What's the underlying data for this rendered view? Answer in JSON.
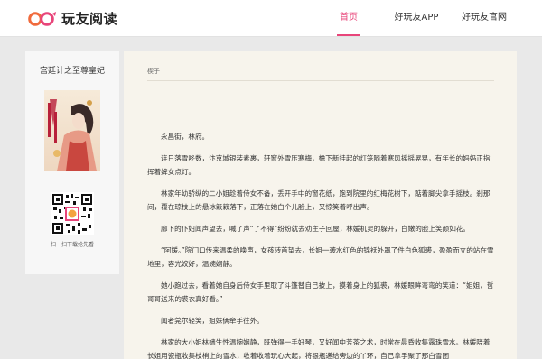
{
  "header": {
    "logo_text": "玩友阅读",
    "nav": [
      {
        "label": "首页",
        "active": true
      },
      {
        "label": "好玩友APP",
        "active": false
      },
      {
        "label": "好玩友官网",
        "active": false
      }
    ],
    "accent_color": "#e8457a"
  },
  "sidebar": {
    "book_title": "宫廷计之至尊皇妃",
    "scan_label": "扫一扫下载抢先看"
  },
  "main": {
    "breadcrumb": "楔子",
    "paragraphs": [
      "永昌街，林府。",
      "连日落雪咚数，汴京城银装素裹，轩窗外雪压寒梅，檐下新挂起的灯笼随着寒风摇摇晃晃，有年长的妈妈正指挥着婢女点灯。",
      "林家年幼骄纵的二小姐趁着侍女不备，丢开手中的窗花纸，跑到院里的红梅花树下，踮着脚尖拿手摇枝。剎那间，覆在琼枝上的悬冰簌簌落下，正落在她白个儿脸上，又惊笑着呼出声。",
      "廊下的仆妇闻声望去，喊了声“了不得”纷纷就去劝主子回屋，林媛机灵的躲开，白嫩的脸上笑颜如花。",
      "“阿媛。”院门口传来温柔的唤声，女孩转首望去，长姐一袭水红色的锦袄外罩了件白色狐裘，盈盈而立的站在雪地里，容光姣好，温婉娴静。",
      "她小跑过去，看着她自身后侍女手里取了斗篷替自己披上，摸着身上的狐裘，林媛眼眸弯弯的笑道：“姐姐，哲哥哥送来的裘衣真好看。”",
      "闻者莞尔轻笑，姐妹俩牵手往外。",
      "林家的大小姐林嫱生性温婉娴静，既弹得一手好琴，又好闻中芳茶之术，时常在晨昏收集露珠雪水。林媛陪着长姐用瓷瓶收集枝梢上的雪水，收着收着玩心大起，将银瓶递给旁边的丫环，自己拿手聚了那白雪团"
    ]
  }
}
